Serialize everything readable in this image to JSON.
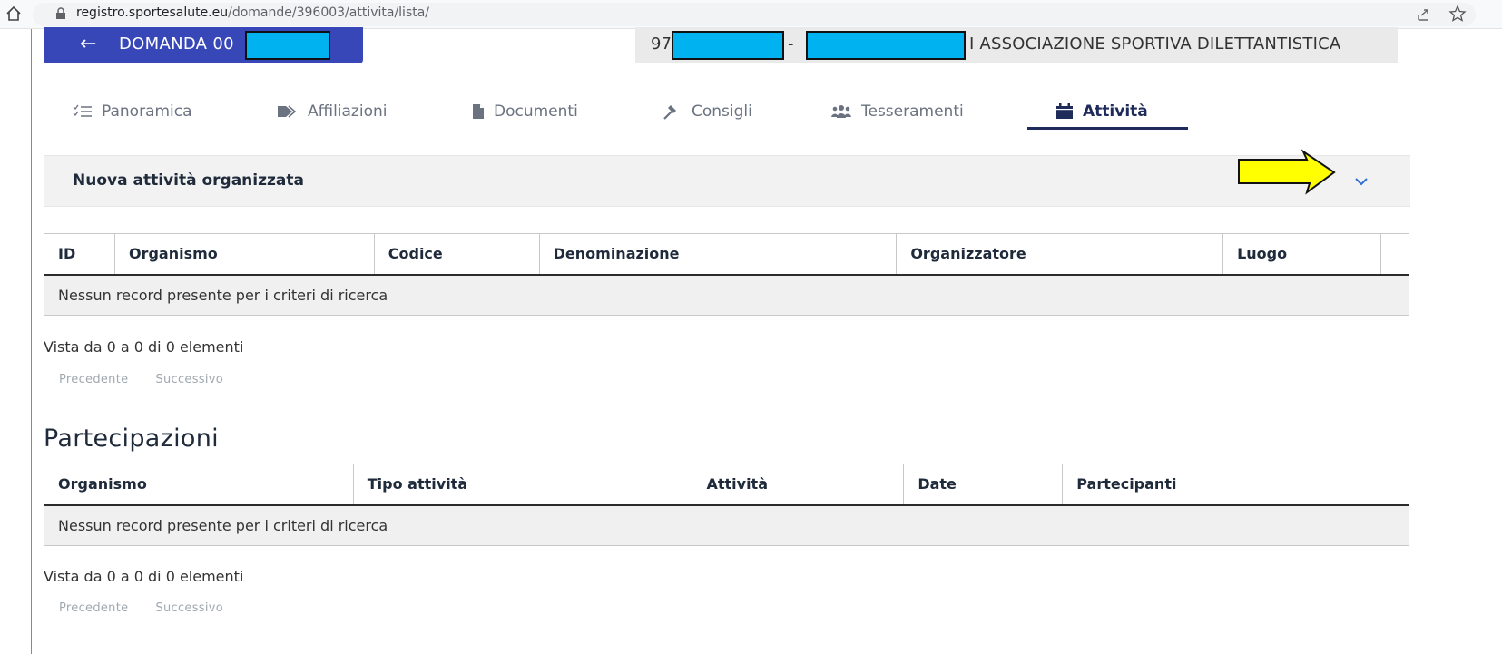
{
  "browser": {
    "url_host": "registro.sportesalute.eu",
    "url_path": "/domande/396003/attivita/lista/"
  },
  "header": {
    "back_arrow": "←",
    "back_label": "DOMANDA 00",
    "title_prefix": "97",
    "title_dash": "-",
    "title_suffix": "I ASSOCIAZIONE SPORTIVA DILETTANTISTICA"
  },
  "tabs": [
    {
      "label": "Panoramica",
      "icon": "list-check-icon"
    },
    {
      "label": "Affiliazioni",
      "icon": "tag-icon"
    },
    {
      "label": "Documenti",
      "icon": "file-icon"
    },
    {
      "label": "Consigli",
      "icon": "gavel-icon"
    },
    {
      "label": "Tesseramenti",
      "icon": "users-icon"
    },
    {
      "label": "Attività",
      "icon": "calendar-icon",
      "active": true
    }
  ],
  "panel": {
    "title": "Nuova attività organizzata",
    "chevron": "chevron-down-icon"
  },
  "activities_table": {
    "headers": [
      "ID",
      "Organismo",
      "Codice",
      "Denominazione",
      "Organizzatore",
      "Luogo",
      ""
    ],
    "empty_text": "Nessun record presente per i criteri di ricerca",
    "info": "Vista da 0 a 0 di 0 elementi",
    "prev": "Precedente",
    "next": "Successivo"
  },
  "participations": {
    "title": "Partecipazioni",
    "headers": [
      "Organismo",
      "Tipo attività",
      "Attività",
      "Date",
      "Partecipanti"
    ],
    "empty_text": "Nessun record presente per i criteri di ricerca",
    "info": "Vista da 0 a 0 di 0 elementi",
    "prev": "Precedente",
    "next": "Successivo"
  },
  "colors": {
    "brand_blue": "#3847b8",
    "active_tab": "#1f2b5a",
    "redaction": "#00b3f0",
    "annotation_arrow": "#ffff00"
  }
}
